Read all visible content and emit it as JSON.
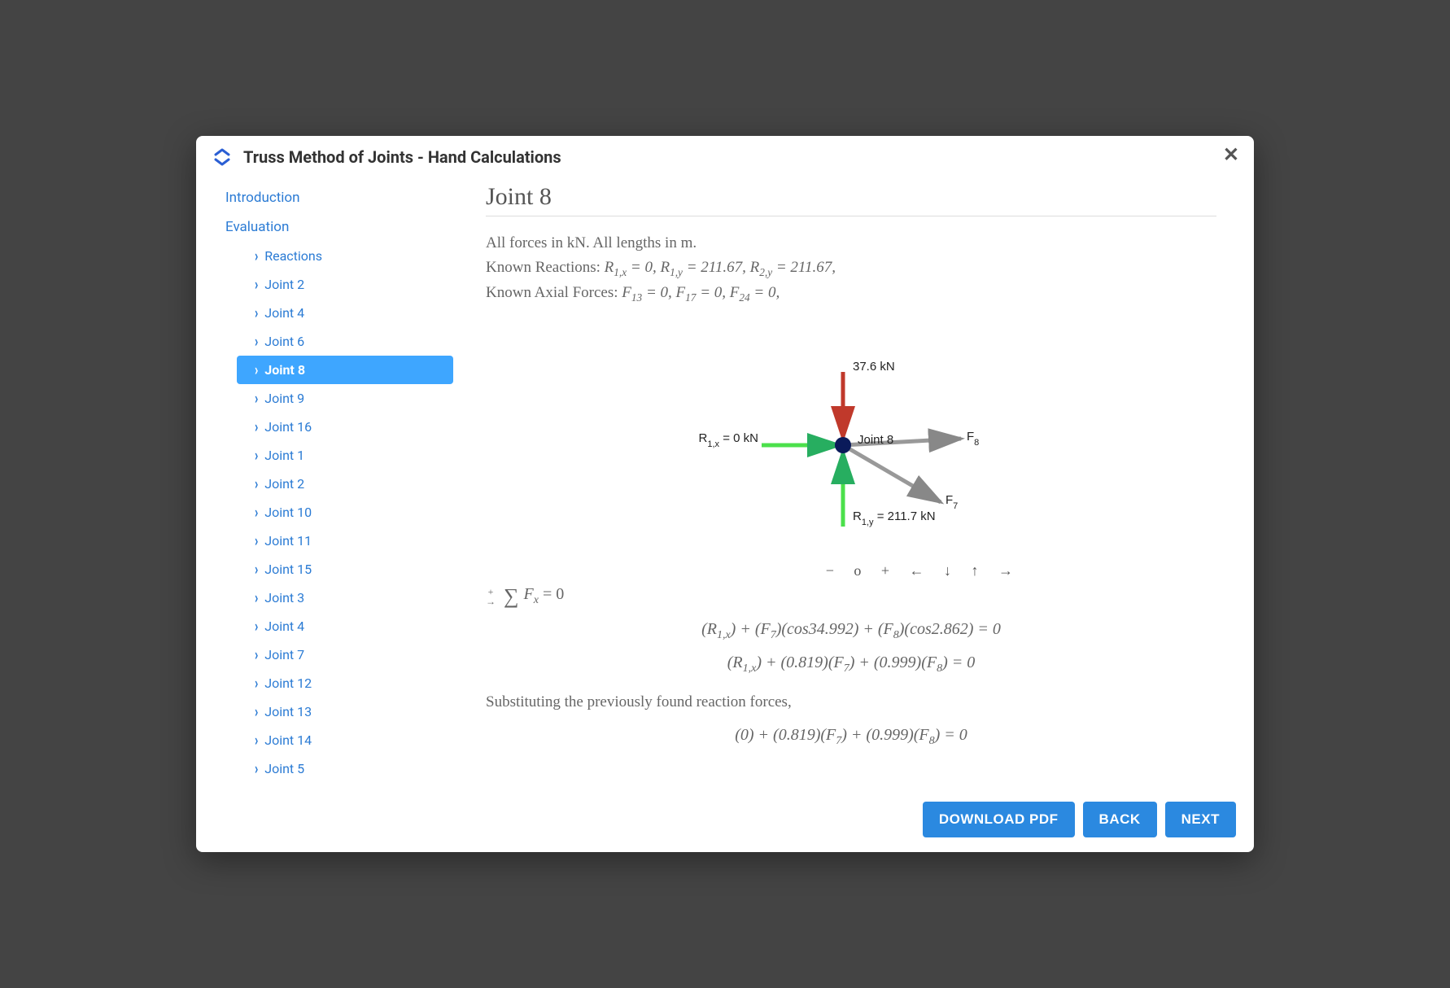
{
  "header": {
    "title": "Truss Method of Joints - Hand Calculations"
  },
  "sidebar": {
    "top": [
      {
        "label": "Introduction"
      },
      {
        "label": "Evaluation"
      }
    ],
    "items": [
      {
        "label": "Reactions",
        "active": false
      },
      {
        "label": "Joint 2",
        "active": false
      },
      {
        "label": "Joint 4",
        "active": false
      },
      {
        "label": "Joint 6",
        "active": false
      },
      {
        "label": "Joint 8",
        "active": true
      },
      {
        "label": "Joint 9",
        "active": false
      },
      {
        "label": "Joint 16",
        "active": false
      },
      {
        "label": "Joint 1",
        "active": false
      },
      {
        "label": "Joint 2",
        "active": false
      },
      {
        "label": "Joint 10",
        "active": false
      },
      {
        "label": "Joint 11",
        "active": false
      },
      {
        "label": "Joint 15",
        "active": false
      },
      {
        "label": "Joint 3",
        "active": false
      },
      {
        "label": "Joint 4",
        "active": false
      },
      {
        "label": "Joint 7",
        "active": false
      },
      {
        "label": "Joint 12",
        "active": false
      },
      {
        "label": "Joint 13",
        "active": false
      },
      {
        "label": "Joint 14",
        "active": false
      },
      {
        "label": "Joint 5",
        "active": false
      }
    ]
  },
  "content": {
    "heading": "Joint 8",
    "units_line": "All forces in kN. All lengths in m.",
    "reactions_prefix": "Known Reactions: ",
    "reactions_math": "R₁,ₓ = 0, R₁,ᵧ = 211.67, R₂,ᵧ = 211.67,",
    "axial_prefix": "Known Axial Forces: ",
    "axial_math": "F₁₃ = 0, F₁₇ = 0, F₂₄ = 0,",
    "diagram": {
      "load_label": "37.6 kN",
      "joint_label": "Joint 8",
      "rx_label": "R₁,ₓ = 0 kN",
      "ry_label": "R₁,ᵧ = 211.7 kN",
      "f7_label": "F₇",
      "f8_label": "F₈",
      "controls": "−  o  +  ←  ↓  ↑  →"
    },
    "eq_sumfx": "∑ Fₓ = 0",
    "eq1": "(R₁,ₓ) + (F₇)(cos34.992) + (F₈)(cos2.862) = 0",
    "eq2": "(R₁,ₓ) + (0.819)(F₇) + (0.999)(F₈) = 0",
    "subst_text": "Substituting the previously found reaction forces,",
    "eq3": "(0) + (0.819)(F₇) + (0.999)(F₈) = 0"
  },
  "footer": {
    "download": "DOWNLOAD PDF",
    "back": "BACK",
    "next": "NEXT"
  }
}
